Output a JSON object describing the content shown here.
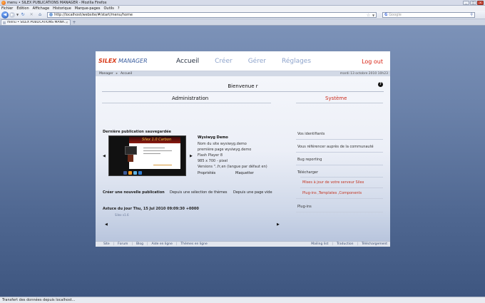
{
  "browser": {
    "window_title": "menu • SILEX PUBLICATIONS MANAGER - Mozilla Firefox",
    "menu": [
      "Fichier",
      "Édition",
      "Affichage",
      "Historique",
      "Marque-pages",
      "Outils",
      "?"
    ],
    "url": "http://localhost/website/#/start/menu/home",
    "search_placeholder": "Google",
    "tab_label": "menu • SILEX PUBLICATIONS MANA...",
    "status": "Transfert des données depuis localhost..."
  },
  "app": {
    "logo_silex": "SILEX",
    "logo_manager": "MANAGER",
    "nav": [
      "Accueil",
      "Créer",
      "Gérer",
      "Réglages"
    ],
    "logout": "Log out",
    "breadcrumb": [
      "Manager",
      "Accueil"
    ],
    "date": "mardi 13 octobre 2010 10h23",
    "welcome": "Bienvenue r",
    "help": "?",
    "admin_title": "Administration",
    "system_title": "Système",
    "last_pub_title": "Dernière publication sauvegardée",
    "thumb_caption": "Silex 1.0 Carbon",
    "demo": {
      "title": "Wysiwyg Demo",
      "lines": [
        "Nom du site wysiwyg.demo",
        "première page wysiwyg.demo",
        "Flash Player 8",
        "985 x 700 - pixel",
        "Versions \"..fr,en (langue par défaut en)"
      ],
      "properties": "Propriétés",
      "mockup": "Maquetter"
    },
    "create": {
      "title": "Créer une nouvelle publication",
      "from_themes": "Depuis une sélection de thèmes",
      "from_blank": "Depuis une page vide"
    },
    "tip": "Astuce du jour Thu, 15 Jul 2010 09:09:30 +0000",
    "silex_version": "Silex v1.6",
    "system_items": [
      {
        "label": "Vos identifiants",
        "kind": "dark"
      },
      {
        "label": "Vous référencer auprès de la communauté",
        "kind": "dark"
      },
      {
        "label": "Bug reporting",
        "kind": "dark"
      },
      {
        "label": "Télécharger",
        "kind": "dark"
      },
      {
        "label": "Mises à jour de votre serveur Silex",
        "kind": "red"
      },
      {
        "label": "Plug-ins ,Templates ,Components",
        "kind": "red"
      },
      {
        "label": "Plug-ins",
        "kind": "dark"
      }
    ],
    "footer_left": [
      "Site",
      "Forum",
      "Blog",
      "Aide en ligne",
      "Thèmes en ligne"
    ],
    "footer_right": [
      "Mailing list",
      "Traduction",
      "Téléchargement"
    ]
  },
  "colors": {
    "accent_red": "#d91f10",
    "nav_blue": "#8ea4cc",
    "page_bg": "#6b82aa"
  }
}
